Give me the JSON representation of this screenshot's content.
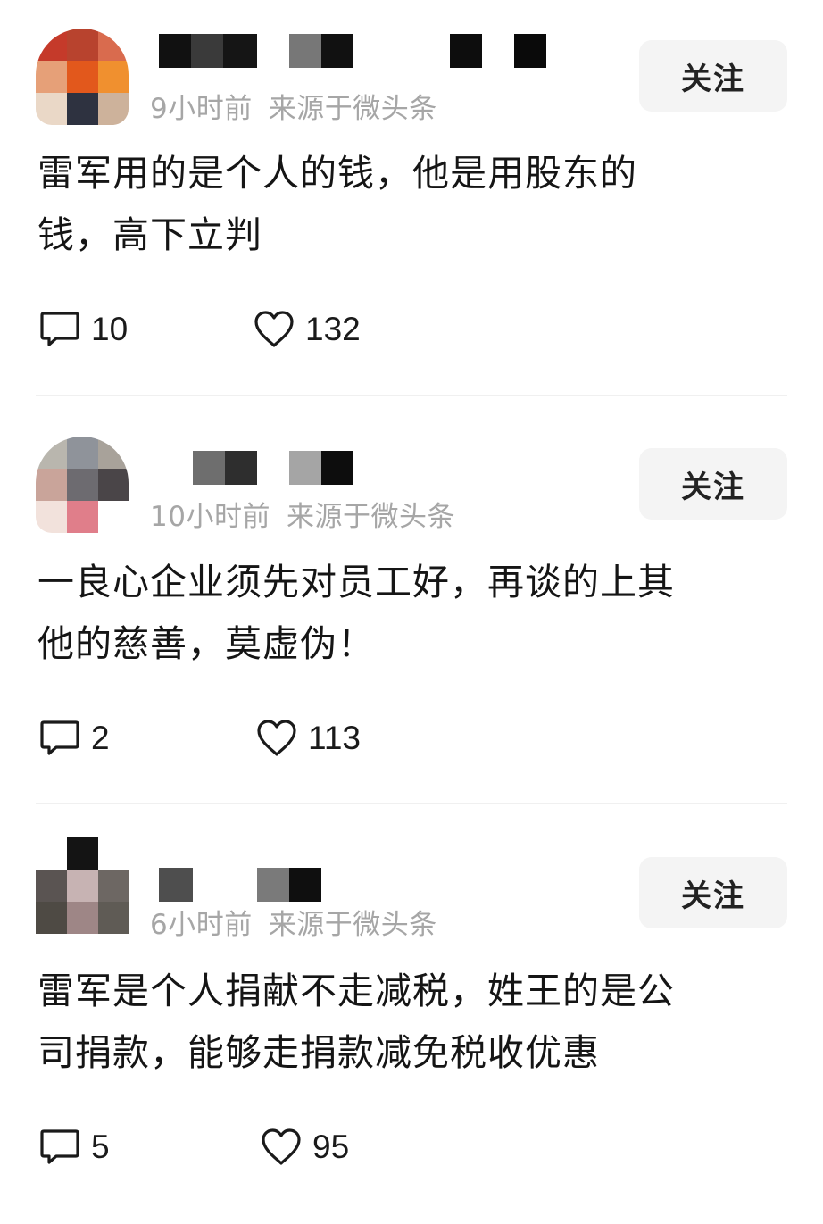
{
  "follow_label": "关注",
  "source_label": "来源于微头条",
  "comments": [
    {
      "time": "9小时前",
      "text_line1": "雷军用的是个人的钱，他是用股东的",
      "text_line2": "钱，高下立判",
      "reply_count": "10",
      "like_count": "132"
    },
    {
      "time": "10小时前",
      "text_line1": "一良心企业须先对员工好，再谈的上其",
      "text_line2": "他的慈善，莫虚伪！",
      "reply_count": "2",
      "like_count": "113"
    },
    {
      "time": "6小时前",
      "text_line1": "雷军是个人捐献不走减税，姓王的是公",
      "text_line2": "司捐款，能够走捐款减免税收优惠",
      "reply_count": "5",
      "like_count": "95"
    }
  ],
  "icons": {
    "reply": "comment-bubble-icon",
    "like": "heart-icon"
  },
  "colors": {
    "background": "#ffffff",
    "meta_text": "#a6a6a6",
    "follow_button_bg": "#f4f4f4",
    "body_text": "#151515"
  }
}
